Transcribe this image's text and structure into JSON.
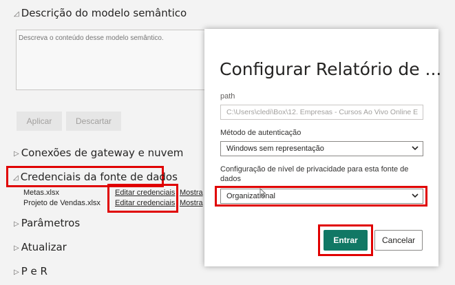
{
  "left": {
    "description": {
      "title": "Descrição do modelo semântico",
      "placeholder": "Descreva o conteúdo desse modelo semântico.",
      "apply_label": "Aplicar",
      "discard_label": "Descartar"
    },
    "gateway_title": "Conexões de gateway e nuvem",
    "credentials": {
      "title": "Credenciais da fonte de dados",
      "rows": [
        {
          "file": "Metas.xlsx",
          "edit": "Editar credenciais",
          "show": "Mostra"
        },
        {
          "file": "Projeto de Vendas.xlsx",
          "edit": "Editar credenciais",
          "show": "Mostra"
        }
      ]
    },
    "params_title": "Parâmetros",
    "refresh_title": "Atualizar",
    "qa_title": "P e R"
  },
  "dialog": {
    "title": "Configurar Relatório de ...",
    "path_label": "path",
    "path_value": "C:\\Users\\cledi\\Box\\12. Empresas - Cursos Ao Vivo Online E",
    "auth_label": "Método de autenticação",
    "auth_value": "Windows sem representação",
    "privacy_label": "Configuração de nível de privacidade para esta fonte de dados",
    "privacy_value": "Organizational",
    "enter_label": "Entrar",
    "cancel_label": "Cancelar"
  },
  "colors": {
    "highlight": "#e00000",
    "primary_button": "#117865",
    "background": "#f3f3f3"
  }
}
